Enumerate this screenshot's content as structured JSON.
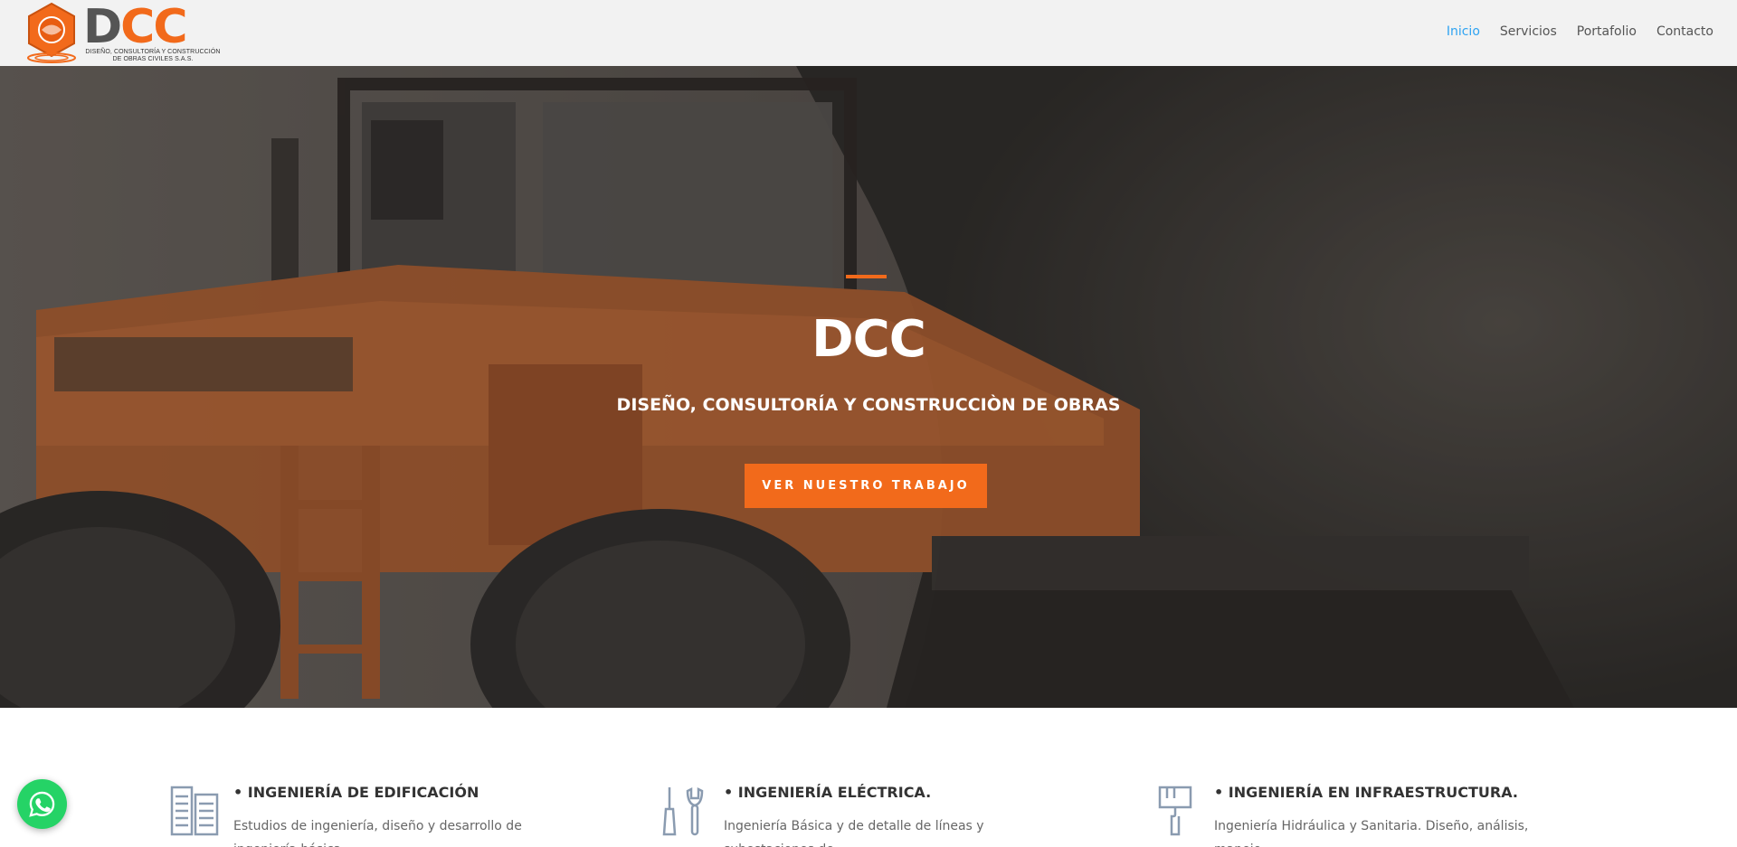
{
  "header": {
    "logo": {
      "brand": "DCC",
      "tagline": "DISEÑO, CONSULTORÍA Y CONSTRUCCIÓN DE OBRAS CIVILES S.A.S."
    },
    "nav": [
      {
        "label": "Inicio",
        "active": true
      },
      {
        "label": "Servicios",
        "active": false
      },
      {
        "label": "Portafolio",
        "active": false
      },
      {
        "label": "Contacto",
        "active": false
      }
    ]
  },
  "hero": {
    "title": "DCC",
    "subtitle": "DISEÑO, CONSULTORÍA Y CONSTRUCCIÒN DE OBRAS",
    "cta_label": "VER NUESTRO TRABAJO"
  },
  "services": [
    {
      "title": "• INGENIERÍA DE EDIFICACIÓN",
      "description": "Estudios de ingeniería, diseño y desarrollo de ingeniería básica ....",
      "icon": "document-lines-icon"
    },
    {
      "title": "• INGENIERÍA ELÉCTRICA.",
      "description": "Ingeniería Básica y de detalle de líneas y subestaciones de ....",
      "icon": "tools-icon"
    },
    {
      "title": "• INGENIERÍA EN INFRAESTRUCTURA.",
      "description": "Ingeniería Hidráulica y Sanitaria. Diseño, análisis, manejo .....",
      "icon": "paint-roller-icon"
    }
  ],
  "colors": {
    "accent": "#f26a1b",
    "nav_active": "#2ea3f2",
    "header_bg": "#f2f2f2",
    "whatsapp": "#25d366"
  }
}
